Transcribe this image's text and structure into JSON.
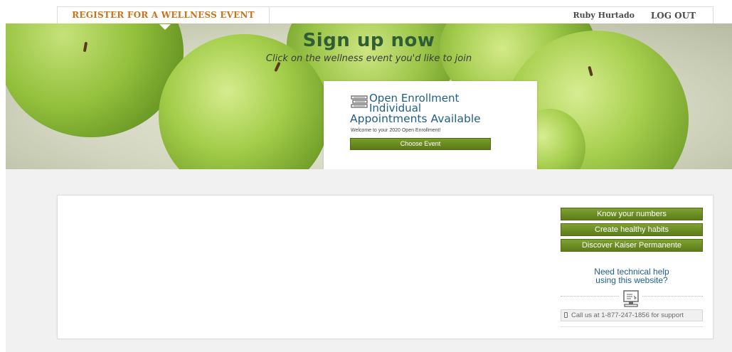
{
  "nav": {
    "tab_label": "REGISTER FOR A WELLNESS EVENT",
    "user_name": "Ruby Hurtado",
    "logout_label": "LOG OUT"
  },
  "hero": {
    "title": "Sign up now",
    "subtitle": "Click on the wellness event you'd like to join"
  },
  "event": {
    "icon": "books-icon",
    "title_line1": "Open Enrollment",
    "title_line2": "Individual",
    "title_line3": "Appointments Available",
    "welcome": "Welcome to your 2020 Open Enrollment!",
    "button_label": "Choose Event"
  },
  "sidebar": {
    "buttons": [
      {
        "label": "Know your numbers"
      },
      {
        "label": "Create healthy habits"
      },
      {
        "label": "Discover Kaiser Permanente"
      }
    ],
    "help_line1": "Need technical help",
    "help_line2": "using this website?",
    "help_icon": "computer-icon",
    "call_text": "Call us at 1-877-247-1856 for support",
    "call_icon": "phone-icon"
  },
  "colors": {
    "accent_orange": "#c8741c",
    "title_green": "#2f5d35",
    "link_blue": "#1f5e86",
    "button_green": "#6b8b22"
  }
}
